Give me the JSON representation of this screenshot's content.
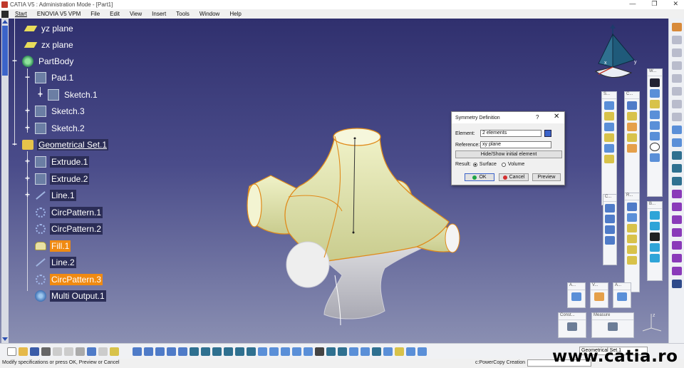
{
  "window": {
    "title": "CATIA V5 : Administration Mode - [Part1]",
    "controls": [
      "—",
      "❐",
      "✕"
    ]
  },
  "menu": {
    "items": [
      "Start",
      "ENOVIA V5 VPM",
      "File",
      "Edit",
      "View",
      "Insert",
      "Tools",
      "Window",
      "Help"
    ]
  },
  "tree": {
    "yz_plane": "yz plane",
    "zx_plane": "zx plane",
    "partbody": "PartBody",
    "pad1": "Pad.1",
    "sketch1": "Sketch.1",
    "sketch3": "Sketch.3",
    "sketch2": "Sketch.2",
    "geoset": "Geometrical Set.1",
    "extrude1": "Extrude.1",
    "extrude2": "Extrude.2",
    "line1": "Line.1",
    "circpattern1": "CircPattern.1",
    "circpattern2": "CircPattern.2",
    "fill1": "Fill.1",
    "line2": "Line.2",
    "circpattern3": "CircPattern.3",
    "multioutput": "Multi Output.1"
  },
  "dialog": {
    "title": "Symmetry Definition",
    "help": "?",
    "close": "✕",
    "element_label": "Element:",
    "element_value": "2 elements",
    "reference_label": "Reference:",
    "reference_value": "xy plane",
    "hide_show_button": "Hide/Show initial element",
    "result_label": "Result:",
    "surface_option": "Surface",
    "volume_option": "Volume",
    "ok_button": "OK",
    "cancel_button": "Cancel",
    "preview_button": "Preview"
  },
  "compass": {
    "x": "x",
    "y": "y"
  },
  "axis_triad": {
    "z": "z"
  },
  "float_toolbars": {
    "t1": "S...",
    "t2": "C...",
    "t3": "W...",
    "t4": "C...",
    "t5": "R...",
    "t6": "B...",
    "t7": "A...",
    "t8": "V...",
    "t9": "A...",
    "const": "Const...",
    "measure": "Measure"
  },
  "bottom": {
    "current_body": "Geometrical Set.1"
  },
  "status": {
    "message": "Modify specifications or press OK, Preview or Cancel",
    "command": "c:PowerCopy Creation"
  },
  "watermark": "www.catia.ro",
  "colors": {
    "viewport_top": "#30306e",
    "viewport_bottom": "#8a8fb2",
    "highlight_orange": "#f08a12",
    "surface_yellow": "#e6e9b4",
    "edge_orange": "#e08a1a"
  }
}
